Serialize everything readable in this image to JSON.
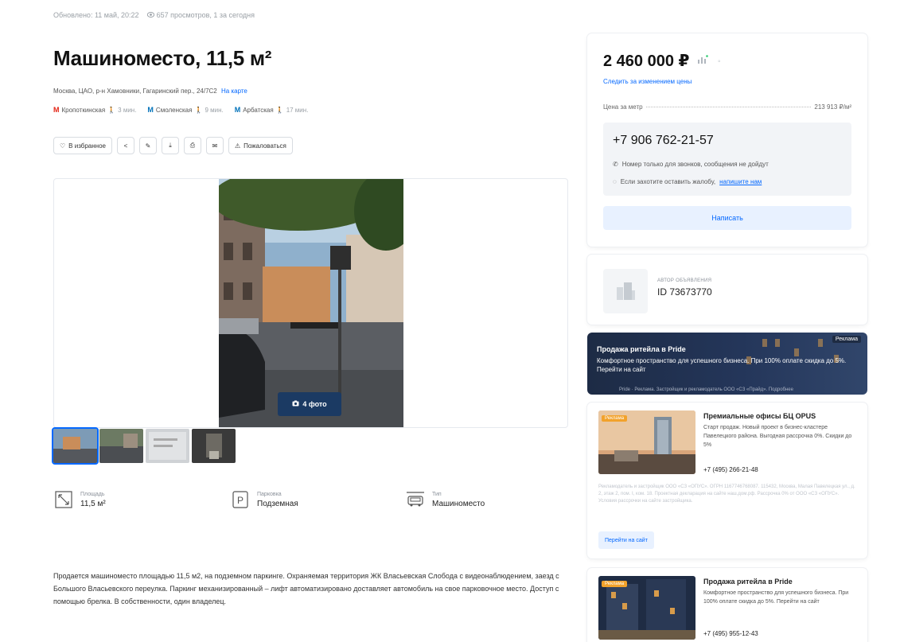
{
  "meta": {
    "updated": "Обновлено: 11 май, 20:22",
    "views": "657 просмотров, 1 за сегодня"
  },
  "title": "Машиноместо, 11,5 м²",
  "address": {
    "text": "Москва, ЦАО, р-н Хамовники, Гагаринский пер., 24/7С2",
    "map_link": "На карте"
  },
  "metro": [
    {
      "name": "Кропоткинская",
      "walk": "3 мин.",
      "color": "#e42313"
    },
    {
      "name": "Смоленская",
      "walk": "9 мин.",
      "color": "#0072ba"
    },
    {
      "name": "Арбатская",
      "walk": "17 мин.",
      "color": "#0072ba"
    }
  ],
  "actions": {
    "favorite": "В избранное",
    "complain": "Пожаловаться"
  },
  "gallery": {
    "photo_count": "4 фото"
  },
  "features": [
    {
      "label": "Площадь",
      "value": "11,5 м²",
      "icon": "area-icon"
    },
    {
      "label": "Парковка",
      "value": "Подземная",
      "icon": "parking-icon"
    },
    {
      "label": "Тип",
      "value": "Машиноместо",
      "icon": "car-icon"
    }
  ],
  "description": "Продается машиноместо площадью 11,5 м2, на подземном паркинге. Охраняемая территория ЖК Власьевская Слобода с видеонаблюдением, заезд с Большого Власьевского переулка. Паркинг механизированный – лифт автоматизировано доставляет автомобиль на свое парковочное место. Доступ с помощью брелка. В собственности, один владелец.",
  "price": {
    "value": "2 460 000 ₽",
    "track": "Следить за изменением цены",
    "per_m_label": "Цена за метр",
    "per_m_value": "213 913 ₽/м²"
  },
  "contact": {
    "phone": "+7 906 762-21-57",
    "note_calls": "Номер только для звонков, сообщения не дойдут",
    "note_complain": "Если захотите оставить жалобу,",
    "note_complain_link": "напишите нам",
    "write_button": "Написать"
  },
  "author": {
    "label": "автор объявления",
    "id": "ID 73673770"
  },
  "banner": {
    "title": "Продажа ритейла в Pride",
    "text": "Комфортное пространство для успешного бизнеса. При 100% оплате скидка до 5%. Перейти на сайт",
    "ad_label": "Реклама",
    "footer": "Pride · Реклама. Застройщик и рекламодатель ООО «СЗ «Прайд». Подробнее"
  },
  "ads": [
    {
      "tag": "Реклама",
      "title": "Премиальные офисы БЦ OPUS",
      "text": "Старт продаж. Новый проект в бизнес-кластере Павелецкого района. Выгодная рассрочка 0%. Скидки до 5%",
      "phone": "+7 (495) 266-21-48",
      "legal": "Рекламодатель и застройщик ООО «СЗ «ОПУС». ОГРН 1167746768087. 115432, Москва, Малая Павелецкая ул., д. 2, этаж 2, пом. I, ком. 18. Проектная декларация на сайте наш.дом.рф. Рассрочка 0% от ООО «СЗ «ОПУС». Условия рассрочки на сайте застройщика.",
      "button": "Перейти на сайт"
    },
    {
      "tag": "Реклама",
      "title": "Продажа ритейла в Pride",
      "text": "Комфортное пространство для успешного бизнеса. При 100% оплате скидка до 5%. Перейти на сайт",
      "phone": "+7 (495) 955-12-43"
    }
  ]
}
